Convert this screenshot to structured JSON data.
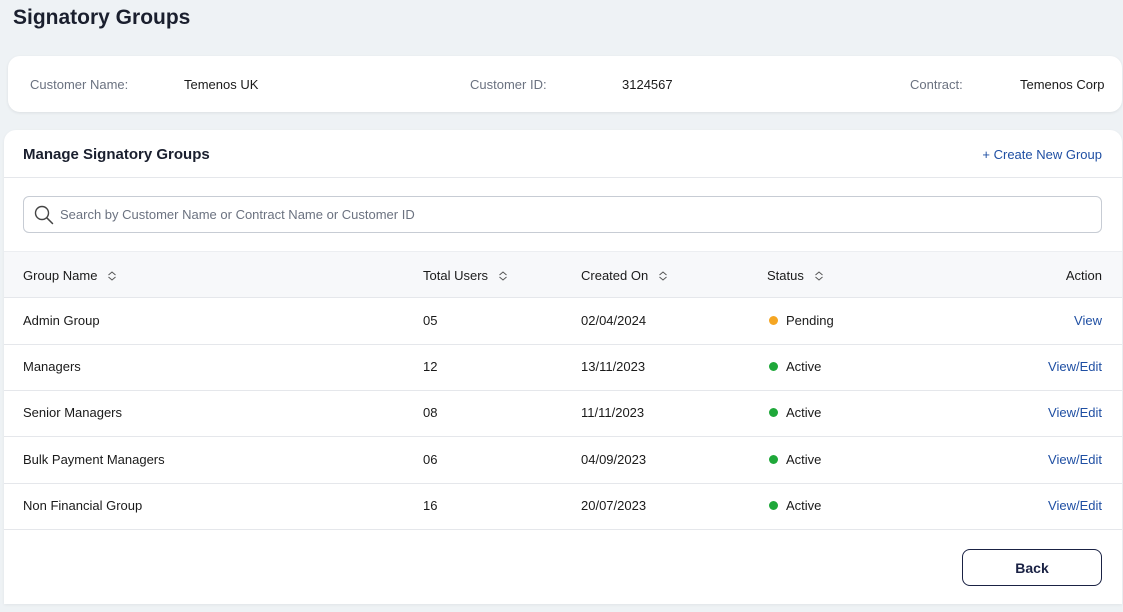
{
  "page": {
    "title": "Signatory Groups"
  },
  "info": {
    "customer_name_label": "Customer Name:",
    "customer_name": "Temenos UK",
    "customer_id_label": "Customer ID:",
    "customer_id": "3124567",
    "contract_label": "Contract:",
    "contract": "Temenos Corp"
  },
  "card": {
    "title": "Manage Signatory Groups",
    "create_link": "+ Create New Group"
  },
  "search": {
    "placeholder": "Search by Customer Name or Contract Name or Customer ID",
    "value": ""
  },
  "table": {
    "columns": [
      "Group Name",
      "Total Users",
      "Created On",
      "Status",
      "Action"
    ],
    "rows": [
      {
        "group": "Admin Group",
        "users": "05",
        "created": "02/04/2024",
        "status": "Pending",
        "action": "View"
      },
      {
        "group": "Managers",
        "users": "12",
        "created": "13/11/2023",
        "status": "Active",
        "action": "View/Edit"
      },
      {
        "group": "Senior Managers",
        "users": "08",
        "created": "11/11/2023",
        "status": "Active",
        "action": "View/Edit"
      },
      {
        "group": "Bulk Payment Managers",
        "users": "06",
        "created": "04/09/2023",
        "status": "Active",
        "action": "View/Edit"
      },
      {
        "group": "Non Financial Group",
        "users": "16",
        "created": "20/07/2023",
        "status": "Active",
        "action": "View/Edit"
      }
    ]
  },
  "colors": {
    "pending": "#f5a623",
    "active": "#1fa83a",
    "link": "#1f4fa3",
    "background": "#eef2f5"
  },
  "footer": {
    "back_label": "Back"
  }
}
